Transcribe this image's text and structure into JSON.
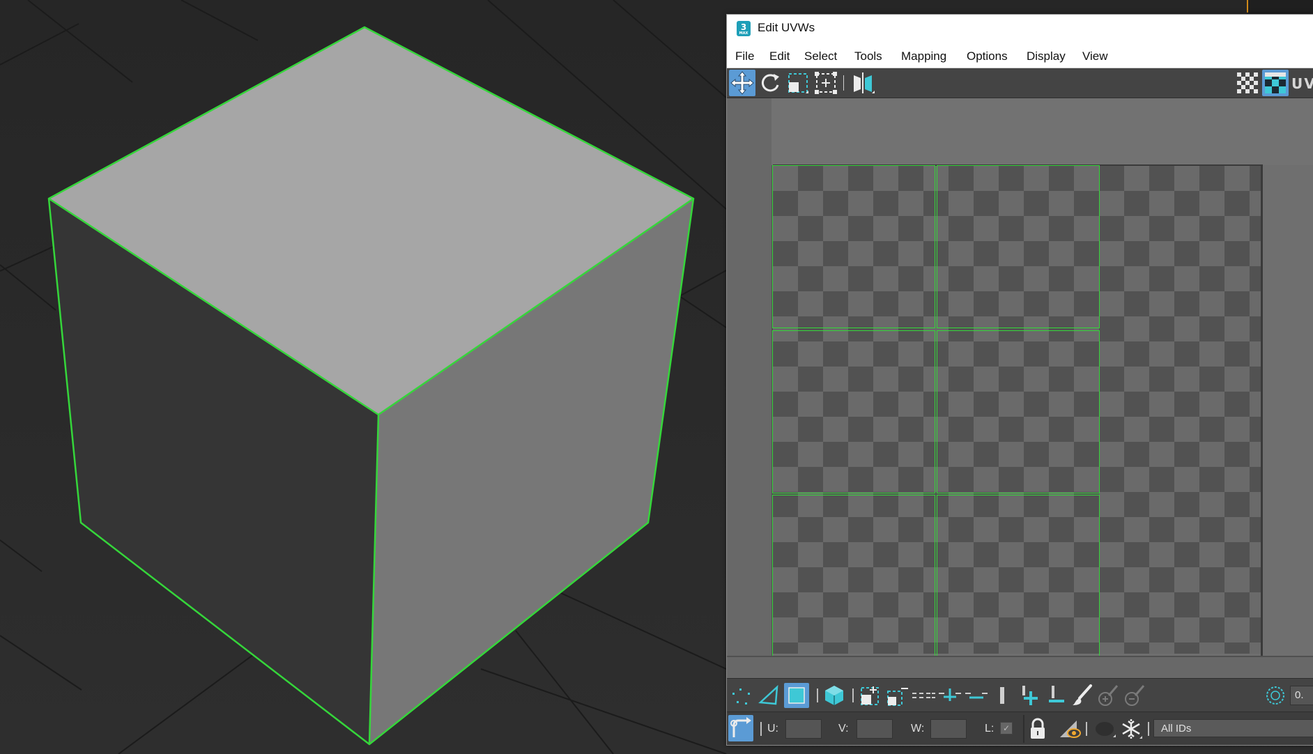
{
  "window": {
    "title": "Edit UVWs",
    "app_logo": "3"
  },
  "menu": [
    "File",
    "Edit",
    "Select",
    "Tools",
    "Mapping",
    "Options",
    "Display",
    "View"
  ],
  "top_toolbar": {
    "icons": [
      "move-icon",
      "rotate-icon",
      "scale-icon",
      "freeform-icon",
      "mirror-icon"
    ],
    "right_icons": [
      "checker-pattern-icon",
      "show-map-icon"
    ],
    "uv_label": "UV"
  },
  "bottom_toolbar": {
    "icons": [
      "vertex-select-icon",
      "edge-select-icon",
      "polygon-select-icon",
      "element-select-icon",
      "grow-select-icon",
      "shrink-select-icon",
      "loop-icon",
      "ring-grow-icon",
      "ring-shrink-icon",
      "point-to-point-icon",
      "paint-select-icon",
      "paint-add-icon",
      "paint-remove-icon",
      "brush-select-icon",
      "brush-grow-icon",
      "brush-shrink-icon",
      "soft-select-icon"
    ],
    "soft_value": "0."
  },
  "status_bar": {
    "u_label": "U:",
    "v_label": "V:",
    "w_label": "W:",
    "l_label": "L:",
    "u_value": "",
    "v_value": "",
    "w_value": "",
    "ids_dropdown": "All IDs"
  },
  "colors": {
    "wire_green": "#35d63a",
    "accent_teal": "#3ec8d6",
    "active_blue": "#5b9bd5",
    "lock_orange": "#f0a830"
  }
}
